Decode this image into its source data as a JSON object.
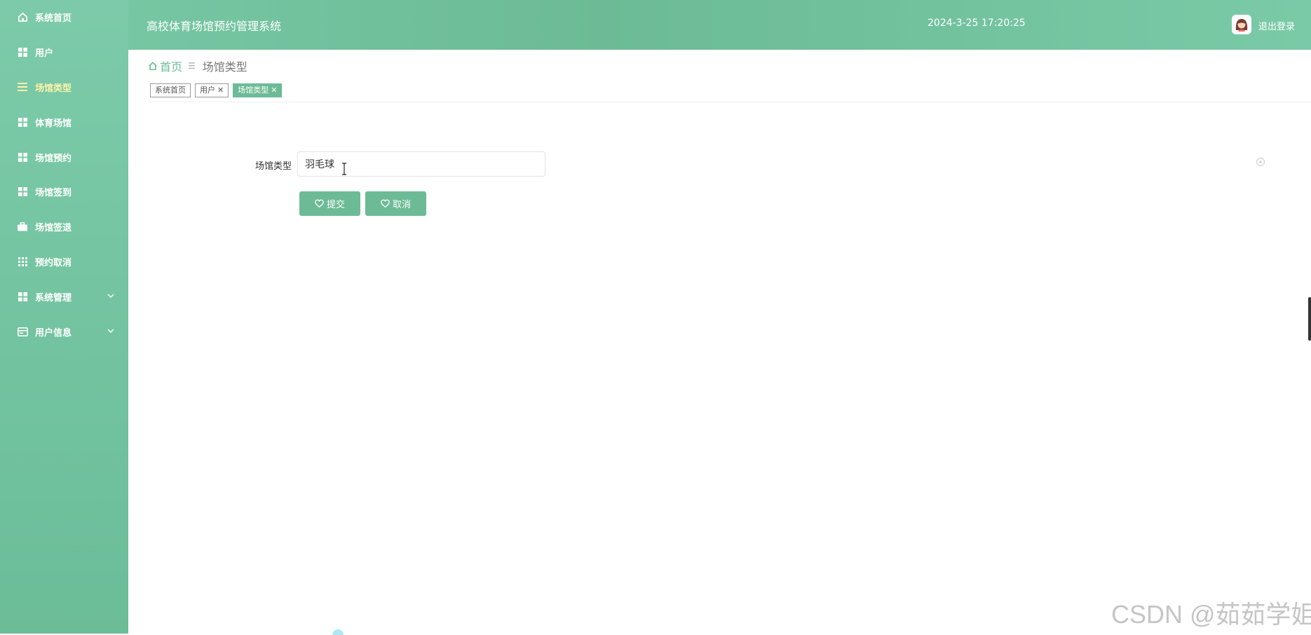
{
  "app": {
    "title": "高校体育场馆预约管理系统",
    "datetime": "2024-3-25 17:20:25",
    "logout_label": "退出登录"
  },
  "colors": {
    "brand": "#6cbb96",
    "active_menu_text": "#fff3a8"
  },
  "sidebar": {
    "items": [
      {
        "label": "系统首页",
        "icon": "home-icon"
      },
      {
        "label": "用户",
        "icon": "grid-icon"
      },
      {
        "label": "场馆类型",
        "icon": "list-icon",
        "active": true
      },
      {
        "label": "体育场馆",
        "icon": "grid-icon"
      },
      {
        "label": "场馆预约",
        "icon": "grid-icon"
      },
      {
        "label": "场馆签到",
        "icon": "grid-icon"
      },
      {
        "label": "场馆签退",
        "icon": "briefcase-icon"
      },
      {
        "label": "预约取消",
        "icon": "apps-icon"
      },
      {
        "label": "系统管理",
        "icon": "grid-icon",
        "expandable": true
      },
      {
        "label": "用户信息",
        "icon": "card-icon",
        "expandable": true
      }
    ]
  },
  "breadcrumb": {
    "home": "首页",
    "current": "场馆类型"
  },
  "tags": [
    {
      "label": "系统首页",
      "closable": false
    },
    {
      "label": "用户",
      "closable": true
    },
    {
      "label": "场馆类型",
      "closable": true,
      "active": true
    }
  ],
  "form": {
    "field_label": "场馆类型",
    "field_value": "羽毛球",
    "submit_label": "提交",
    "cancel_label": "取消"
  },
  "watermark": "CSDN @茹茹学姐"
}
